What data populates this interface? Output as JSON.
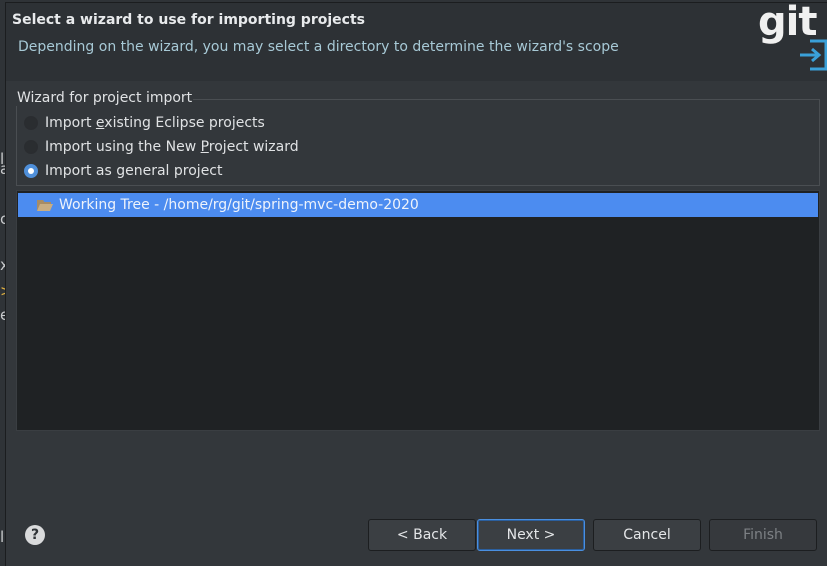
{
  "header": {
    "title": "Select a wizard to use for importing projects",
    "description": "Depending on the wizard, you may select a directory to determine the wizard's scope",
    "logo_text": "git",
    "logo_icon": "import-arrow-icon"
  },
  "wizard_group": {
    "legend": "Wizard for project import",
    "options": [
      {
        "pre": "Import ",
        "mnemonic": "e",
        "post": "xisting Eclipse projects",
        "checked": false
      },
      {
        "pre": "Import using the New ",
        "mnemonic": "P",
        "post": "roject wizard",
        "checked": false
      },
      {
        "pre": "Import as general project",
        "mnemonic": "",
        "post": "",
        "checked": true
      }
    ]
  },
  "tree": {
    "items": [
      {
        "label": "Working Tree - /home/rg/git/spring-mvc-demo-2020",
        "icon": "folder-open-icon",
        "selected": true
      }
    ]
  },
  "buttons": {
    "help": "?",
    "back": "< Back",
    "next": "Next >",
    "cancel": "Cancel",
    "finish": "Finish"
  },
  "background_glyphs": [
    "l",
    "a",
    "c",
    "x",
    ">",
    "e",
    "l"
  ],
  "colors": {
    "accent": "#4c8cf0",
    "header_desc": "#a7c9d6"
  }
}
